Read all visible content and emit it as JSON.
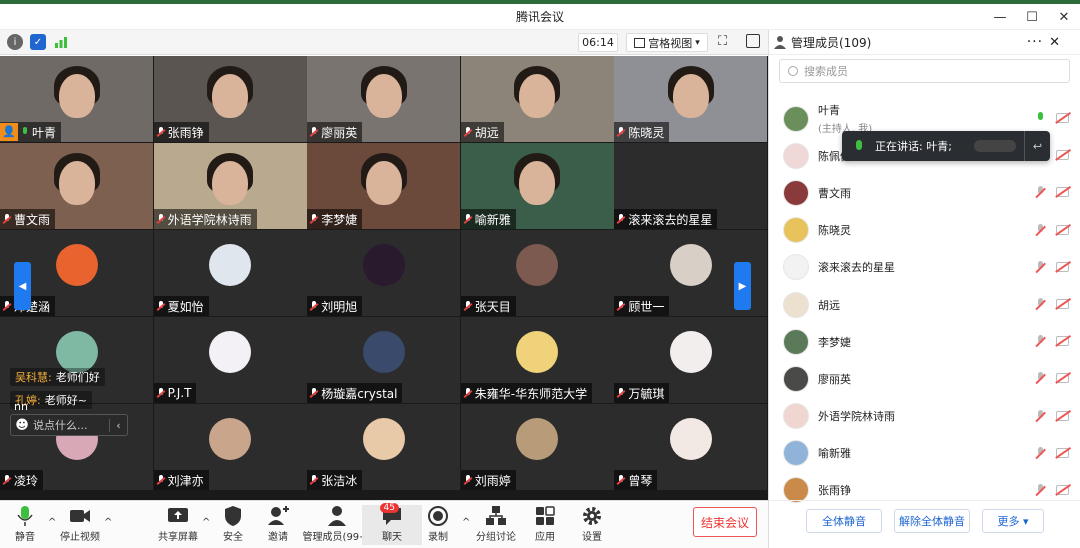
{
  "window": {
    "title": "腾讯会议",
    "controls": {
      "minimize": "—",
      "maximize": "☐",
      "close": "✕"
    }
  },
  "toolbar": {
    "timer": "06:14",
    "view_label": "宫格视图",
    "view_caret": "▾",
    "fullscreen": "⛶"
  },
  "tiles": [
    {
      "name": "叶青",
      "host": true,
      "mic": "on",
      "kind": "video",
      "bg": "#6f6a66"
    },
    {
      "name": "张雨铮",
      "mic": "off",
      "kind": "video",
      "bg": "#5a5550"
    },
    {
      "name": "廖丽英",
      "mic": "off",
      "kind": "video",
      "bg": "#7a7470"
    },
    {
      "name": "胡远",
      "mic": "off",
      "kind": "video",
      "bg": "#8c8478"
    },
    {
      "name": "陈晓灵",
      "mic": "off",
      "kind": "video",
      "bg": "#8f8f96"
    },
    {
      "name": "曹文雨",
      "mic": "off",
      "kind": "video",
      "bg": "#7d6050"
    },
    {
      "name": "外语学院林诗雨",
      "mic": "off",
      "kind": "video",
      "bg": "#b9a98f"
    },
    {
      "name": "李梦婕",
      "mic": "off",
      "kind": "video",
      "bg": "#6b4a3c"
    },
    {
      "name": "喻新雅",
      "mic": "off",
      "kind": "video",
      "bg": "#3b5e4a"
    },
    {
      "name": "滚来滚去的星星",
      "mic": "off",
      "kind": "blank",
      "bg": "#2c2c2c"
    },
    {
      "name": "邓楚涵",
      "mic": "off",
      "kind": "avatar",
      "bg": "#2c2c2c",
      "avatar": "#e8632e"
    },
    {
      "name": "夏如怡",
      "mic": "off",
      "kind": "avatar",
      "bg": "#2c2c2c",
      "avatar": "#dfe6ee"
    },
    {
      "name": "刘明旭",
      "mic": "off",
      "kind": "avatar",
      "bg": "#2c2c2c",
      "avatar": "#2a1a2e"
    },
    {
      "name": "张天目",
      "mic": "off",
      "kind": "avatar",
      "bg": "#2c2c2c",
      "avatar": "#7c5a50"
    },
    {
      "name": "顾世一",
      "mic": "off",
      "kind": "avatar",
      "bg": "#2c2c2c",
      "avatar": "#d8cfc6"
    },
    {
      "name": "",
      "mic": "off",
      "kind": "avatar",
      "bg": "#2c2c2c",
      "avatar": "#7fb9a4"
    },
    {
      "name": "P.J.T",
      "mic": "off",
      "kind": "avatar",
      "bg": "#2c2c2c",
      "avatar": "#f3f0f6"
    },
    {
      "name": "杨璇嘉crystal",
      "mic": "off",
      "kind": "avatar",
      "bg": "#2c2c2c",
      "avatar": "#3a4a6a"
    },
    {
      "name": "朱雍华-华东师范大学",
      "mic": "off",
      "kind": "avatar",
      "bg": "#2c2c2c",
      "avatar": "#f0d27a"
    },
    {
      "name": "万毓琪",
      "mic": "off",
      "kind": "avatar",
      "bg": "#2c2c2c",
      "avatar": "#f2eeee"
    },
    {
      "name": "凌玲",
      "mic": "off",
      "kind": "avatar",
      "bg": "#2c2c2c",
      "avatar": "#d9a8b6"
    },
    {
      "name": "刘津亦",
      "mic": "off",
      "kind": "avatar",
      "bg": "#2c2c2c",
      "avatar": "#c9a58c"
    },
    {
      "name": "张洁冰",
      "mic": "off",
      "kind": "avatar",
      "bg": "#2c2c2c",
      "avatar": "#e8c9a8"
    },
    {
      "name": "刘雨婷",
      "mic": "off",
      "kind": "avatar",
      "bg": "#2c2c2c",
      "avatar": "#b89c7a"
    },
    {
      "name": "曾琴",
      "mic": "off",
      "kind": "avatar",
      "bg": "#2c2c2c",
      "avatar": "#f3e9e4"
    }
  ],
  "chat": {
    "messages": [
      {
        "sender": "吴科慧:",
        "text": "老师们好"
      },
      {
        "sender": "孔婷:",
        "text": "老师好~"
      }
    ],
    "input_placeholder": "说点什么...",
    "emoji": "☻",
    "collapse": "‹",
    "partial_name": "nn"
  },
  "bottombar": {
    "mute": "静音",
    "stop_video": "停止视频",
    "share_screen": "共享屏幕",
    "security": "安全",
    "invite": "邀请",
    "manage_members": "管理成员(99+)",
    "chat": "聊天",
    "chat_badge": "45",
    "record": "录制",
    "breakout": "分组讨论",
    "apps": "应用",
    "settings": "设置",
    "end_meeting": "结束会议",
    "caret": "^"
  },
  "panel": {
    "title": "管理成员(109)",
    "more": "···",
    "close": "✕",
    "search_placeholder": "搜索成员",
    "speaking_label": "正在讲话: 叶青;",
    "speaking_back": "↩",
    "members": [
      {
        "name": "叶青",
        "sub": "(主持人, 我)",
        "mic": "on",
        "color": "#6a8f5a"
      },
      {
        "name": "陈佩佩",
        "mic": "idle",
        "color": "#f0d8d8"
      },
      {
        "name": "曹文雨",
        "mic": "off",
        "color": "#8a3a3a"
      },
      {
        "name": "陈晓灵",
        "mic": "off",
        "color": "#e8c25a"
      },
      {
        "name": "滚来滚去的星星",
        "mic": "off",
        "color": "#f2f2f2"
      },
      {
        "name": "胡远",
        "mic": "off",
        "color": "#ece0cf"
      },
      {
        "name": "李梦婕",
        "mic": "off",
        "color": "#5b7a5a"
      },
      {
        "name": "廖丽英",
        "mic": "off",
        "color": "#4a4a48"
      },
      {
        "name": "外语学院林诗雨",
        "mic": "off",
        "color": "#f0d6d0"
      },
      {
        "name": "喻新雅",
        "mic": "off",
        "color": "#8fb3d9"
      },
      {
        "name": "张雨铮",
        "mic": "off",
        "color": "#c98a4a"
      }
    ],
    "mute_all": "全体静音",
    "unmute_all": "解除全体静音",
    "more_btn": "更多 ▾"
  },
  "colors": {
    "accent": "#1f7af0",
    "end": "#e33333",
    "speaking_green": "#3fbf3f",
    "host_badge": "#f28c1a"
  }
}
